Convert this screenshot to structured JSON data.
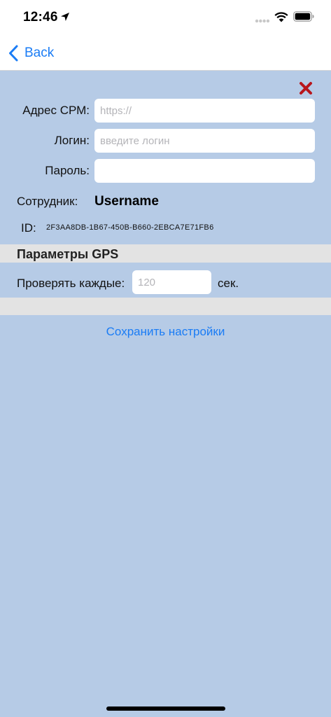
{
  "status_bar": {
    "time": "12:46"
  },
  "nav": {
    "back_label": "Back"
  },
  "form": {
    "address": {
      "label": "Адрес СРМ:",
      "value": "",
      "placeholder": "https://"
    },
    "login": {
      "label": "Логин:",
      "value": "",
      "placeholder": "введите логин"
    },
    "password": {
      "label": "Пароль:",
      "value": "",
      "placeholder": ""
    },
    "employee": {
      "label": "Сотрудник:",
      "value": "Username"
    },
    "id": {
      "label": "ID:",
      "value": "2F3AA8DB-1B67-450B-B660-2EBCA7E71FB6"
    }
  },
  "gps": {
    "section_title": "Параметры GPS",
    "check_label": "Проверять каждые:",
    "interval_value": "",
    "interval_placeholder": "120",
    "unit": "сек."
  },
  "actions": {
    "save_label": "Сохранить настройки"
  },
  "icons": {
    "location": "location-arrow-icon",
    "signal": "cellular-signal-icon",
    "wifi": "wifi-icon",
    "battery": "battery-icon",
    "back": "chevron-left-icon",
    "close": "close-x-icon"
  },
  "colors": {
    "background": "#b6cbe6",
    "accent": "#1a7cf5",
    "close": "#b8161c",
    "section_band": "#e3e3e3"
  }
}
